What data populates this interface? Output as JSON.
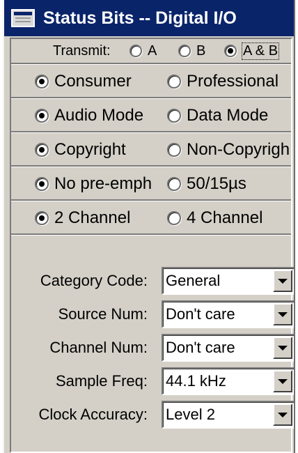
{
  "window": {
    "title": "Status Bits -- Digital I/O"
  },
  "transmit": {
    "label": "Transmit:",
    "options": [
      {
        "label": "A",
        "checked": false
      },
      {
        "label": "B",
        "checked": false
      },
      {
        "label": "A & B",
        "checked": true
      }
    ]
  },
  "radio_rows": [
    {
      "left": {
        "label": "Consumer",
        "checked": true
      },
      "right": {
        "label": "Professional",
        "checked": false
      }
    },
    {
      "left": {
        "label": "Audio Mode",
        "checked": true
      },
      "right": {
        "label": "Data Mode",
        "checked": false
      }
    },
    {
      "left": {
        "label": "Copyright",
        "checked": true
      },
      "right": {
        "label": "Non-Copyrigh",
        "checked": false
      }
    },
    {
      "left": {
        "label": "No pre-emph",
        "checked": true
      },
      "right": {
        "label": "50/15µs",
        "checked": false
      }
    },
    {
      "left": {
        "label": "2 Channel",
        "checked": true
      },
      "right": {
        "label": "4 Channel",
        "checked": false
      }
    }
  ],
  "fields": [
    {
      "label": "Category Code:",
      "value": "General"
    },
    {
      "label": "Source Num:",
      "value": "Don't care"
    },
    {
      "label": "Channel Num:",
      "value": "Don't care"
    },
    {
      "label": "Sample Freq:",
      "value": "44.1 kHz"
    },
    {
      "label": "Clock Accuracy:",
      "value": "Level 2"
    }
  ],
  "icons": {
    "title": "window-icon",
    "dropdown": "chevron-down-icon"
  }
}
